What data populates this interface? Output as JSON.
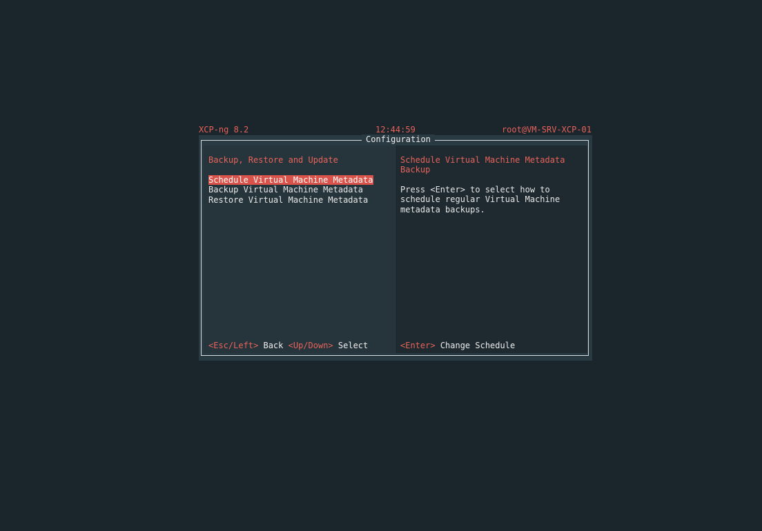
{
  "topbar": {
    "product": "XCP-ng 8.2",
    "time": "12:44:59",
    "host": "root@VM-SRV-XCP-01"
  },
  "dialog": {
    "title": "Configuration"
  },
  "left_pane": {
    "section_title": "Backup, Restore and Update",
    "menu_items": [
      {
        "label": "Schedule Virtual Machine Metadata",
        "selected": true
      },
      {
        "label": "Backup Virtual Machine Metadata",
        "selected": false
      },
      {
        "label": "Restore Virtual Machine Metadata",
        "selected": false
      }
    ],
    "footer": [
      {
        "key": "<Esc/Left>",
        "action": "Back"
      },
      {
        "key": "<Up/Down>",
        "action": "Select"
      }
    ]
  },
  "right_pane": {
    "title": "Schedule Virtual Machine Metadata\nBackup",
    "body": "Press <Enter> to select how to\nschedule regular Virtual Machine\nmetadata backups.",
    "footer": [
      {
        "key": "<Enter>",
        "action": "Change Schedule"
      }
    ]
  },
  "colors": {
    "background": "#1a252c",
    "accent": "#e8635a",
    "selection": "#d9534a",
    "left_pane_bg": "#26353c",
    "right_pane_bg": "#1e2a30",
    "text": "#e8e8e8"
  }
}
